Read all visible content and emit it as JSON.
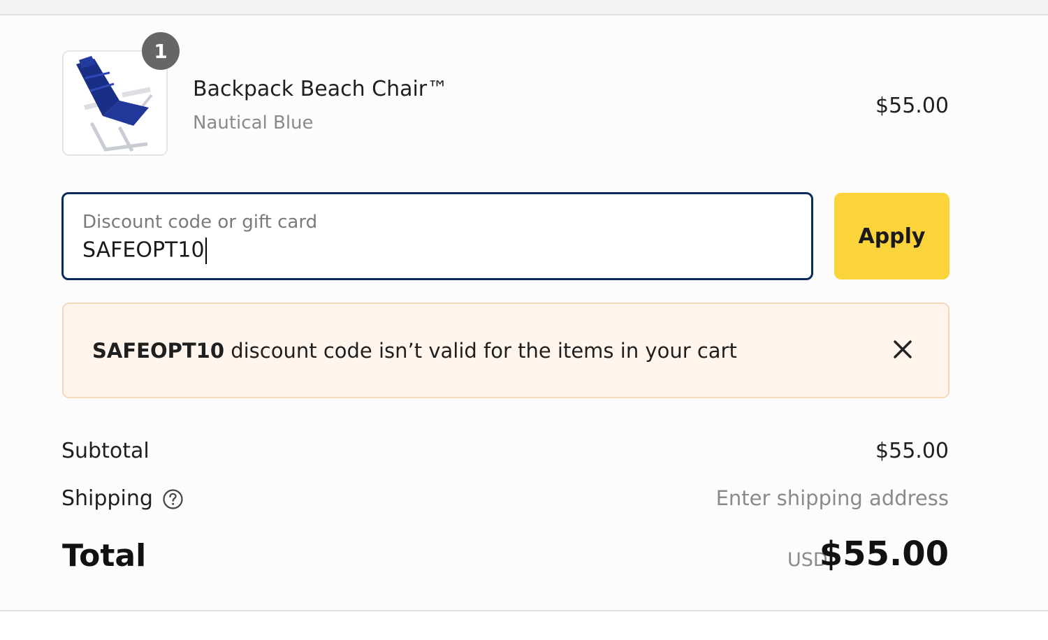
{
  "cart": {
    "items": [
      {
        "quantity": "1",
        "name": "Backpack Beach Chair™",
        "variant": "Nautical Blue",
        "price": "$55.00"
      }
    ]
  },
  "discount": {
    "placeholder": "Discount code or gift card",
    "value": "SAFEOPT10",
    "apply_label": "Apply",
    "error": {
      "code": "SAFEOPT10",
      "message": " discount code isn’t valid for the items in your cart"
    }
  },
  "totals": {
    "subtotal_label": "Subtotal",
    "subtotal_value": "$55.00",
    "shipping_label": "Shipping",
    "shipping_value": "Enter shipping address",
    "total_label": "Total",
    "currency": "USD",
    "total_value": "$55.00"
  },
  "colors": {
    "accent_button": "#fbd33a",
    "input_border": "#0a2a5c",
    "error_background": "#fff5ec",
    "error_border": "#f6d9b8",
    "product_blue": "#1b2e86"
  },
  "icons": {
    "close": "close-icon",
    "help": "help-circle-icon",
    "product": "beach-chair-image"
  }
}
